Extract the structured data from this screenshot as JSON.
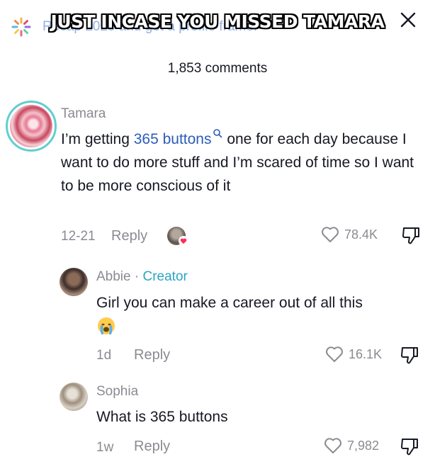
{
  "banner": {
    "text": "Recap 2025 and get a profile frame!",
    "icon": "sparkle-icon"
  },
  "overlay_caption": "JUST INCASE YOU MISSED TAMARA",
  "header": {
    "comment_count": "1,853 comments",
    "close_icon": "close-icon"
  },
  "comments": [
    {
      "author": "Tamara",
      "text_before": "I’m getting ",
      "link_text": "365 buttons",
      "text_after": " one for each day because I want to do more stuff and I’m scared of time so I want to be more conscious of it",
      "date": "12-21",
      "reply_label": "Reply",
      "likes": "78.4K"
    },
    {
      "author": "Abbie",
      "author_separator": "·",
      "author_tag": "Creator",
      "text": "Girl you can make a career out of all this",
      "date": "1d",
      "reply_label": "Reply",
      "likes": "16.1K",
      "emoji": "crying-face-emoji"
    },
    {
      "author": "Sophia",
      "text": "What is 365 buttons",
      "date": "1w",
      "reply_label": "Reply",
      "likes": "7,982"
    }
  ],
  "colors": {
    "link": "#2b5db9",
    "creator": "#2aa5c4",
    "muted": "#8a8b91",
    "avatar_ring": "#5fd0cf",
    "heart_badge": "#fe2c55"
  }
}
